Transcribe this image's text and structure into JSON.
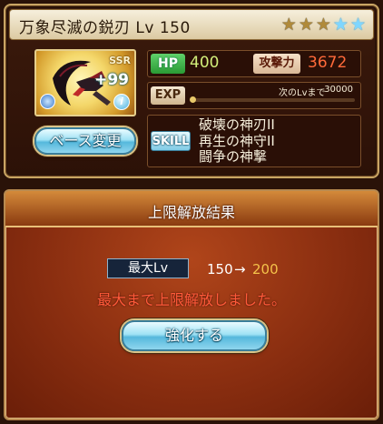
{
  "item": {
    "name": "万象尽滅の鋭刃",
    "level_text": "Lv 150",
    "rarity_badge": "SSR",
    "plus_bonus": "+99",
    "info_glyph": "i",
    "stars": {
      "gold": 3,
      "blue": 2,
      "total": 5
    },
    "colors": {
      "gold_star": "#b08a3a",
      "blue_star": "#7fd6ff"
    }
  },
  "buttons": {
    "base_change": "ベース変更",
    "enhance": "強化する"
  },
  "stats": {
    "hp_label": "HP",
    "hp_value": "400",
    "atk_label": "攻撃力",
    "atk_value": "3672",
    "exp_label": "EXP",
    "exp_next_label": "次のLvまで",
    "exp_next_value": "30000",
    "exp_progress": 0.0
  },
  "skills": {
    "label": "SKILL",
    "items": [
      "破壊の神刃II",
      "再生の神守II",
      "闘争の神撃"
    ]
  },
  "dialog": {
    "title": "上限解放結果",
    "max_lv_label": "最大Lv",
    "level_before": "150",
    "arrow": "→",
    "level_after": "200",
    "message": "最大まで上限解放しました。"
  }
}
